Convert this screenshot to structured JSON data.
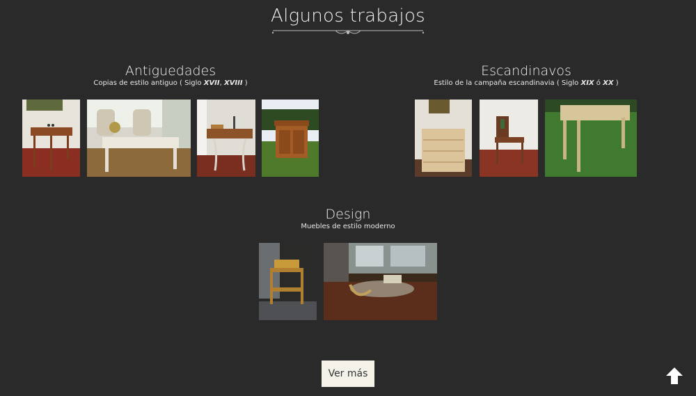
{
  "page": {
    "title": "Algunos trabajos"
  },
  "sections": [
    {
      "title": "Antiguedades",
      "sub_prefix": "Copias de estilo antiguo ( Siglo ",
      "sub_em1": "XVII",
      "sub_mid": ", ",
      "sub_em2": "XVIII",
      "sub_suffix": " )"
    },
    {
      "title": "Escandinavos",
      "sub_prefix": "Estilo de la campaña escandinavia ( Siglo ",
      "sub_em1": "XIX",
      "sub_mid": " ó ",
      "sub_em2": "XX",
      "sub_suffix": " )"
    },
    {
      "title": "Design",
      "sub": "Muebles de estilo moderno"
    }
  ],
  "buttons": {
    "more_label": "Ver más"
  },
  "icons": {
    "scroll_top": "arrow-up-icon",
    "flourish": "ornament-divider-icon"
  }
}
